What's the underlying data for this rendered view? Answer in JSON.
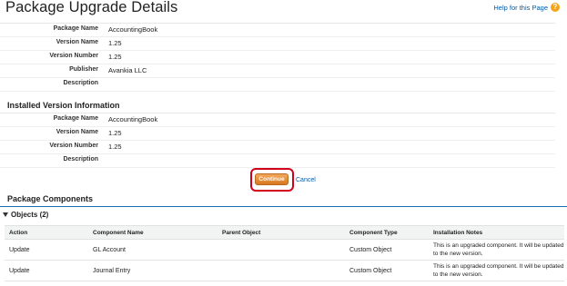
{
  "page": {
    "title": "Package Upgrade Details",
    "help_label": "Help for this Page",
    "help_icon": "question-icon"
  },
  "package_details": [
    {
      "label": "Package Name",
      "value": "AccountingBook"
    },
    {
      "label": "Version Name",
      "value": "1.25"
    },
    {
      "label": "Version Number",
      "value": "1.25"
    },
    {
      "label": "Publisher",
      "value": "Avankia LLC"
    },
    {
      "label": "Description",
      "value": ""
    }
  ],
  "installed_version": {
    "title": "Installed Version Information",
    "rows": [
      {
        "label": "Package Name",
        "value": "AccountingBook"
      },
      {
        "label": "Version Name",
        "value": "1.25"
      },
      {
        "label": "Version Number",
        "value": "1.25"
      },
      {
        "label": "Description",
        "value": ""
      }
    ]
  },
  "actions": {
    "continue_label": "Continue",
    "cancel_label": "Cancel",
    "highlight_color": "#d1001b"
  },
  "package_components": {
    "title": "Package Components",
    "objects_label": "Objects (2)",
    "columns": [
      "Action",
      "Component Name",
      "Parent Object",
      "Component Type",
      "Installation Notes"
    ],
    "rows": [
      {
        "action": "Update",
        "name": "GL Account",
        "parent": "",
        "type": "Custom Object",
        "notes": "This is an upgraded component. It will be updated to the new version."
      },
      {
        "action": "Update",
        "name": "Journal Entry",
        "parent": "",
        "type": "Custom Object",
        "notes": "This is an upgraded component. It will be updated to the new version."
      }
    ]
  }
}
